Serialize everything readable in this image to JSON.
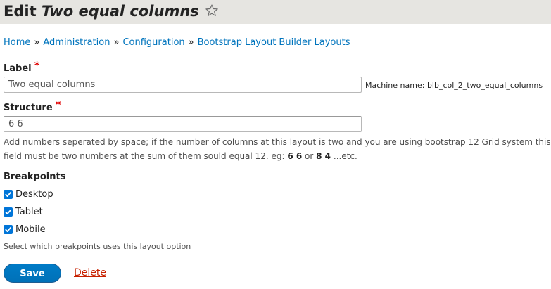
{
  "header": {
    "title_prefix": "Edit",
    "title_entity": "Two equal columns",
    "star_icon": "star-outline-icon"
  },
  "breadcrumb": {
    "items": [
      "Home",
      "Administration",
      "Configuration",
      "Bootstrap Layout Builder Layouts"
    ],
    "separator": "»"
  },
  "form": {
    "label": {
      "title": "Label",
      "required_mark": "*",
      "value": "Two equal columns",
      "machine_name": "Machine name: blb_col_2_two_equal_columns"
    },
    "structure": {
      "title": "Structure",
      "required_mark": "*",
      "value": "6 6",
      "description_part1": "Add numbers seperated by space; if the number of columns at this layout is two and you are using bootstrap 12 Grid system this field must be two numbers at the sum of them sould equal 12. eg:",
      "example_1": "6 6",
      "or_word": "or",
      "example_2": "8 4",
      "description_end": "...etc."
    },
    "breakpoints": {
      "title": "Breakpoints",
      "options": [
        {
          "label": "Desktop",
          "checked": true
        },
        {
          "label": "Tablet",
          "checked": true
        },
        {
          "label": "Mobile",
          "checked": true
        }
      ],
      "help": "Select which breakpoints uses this layout option"
    }
  },
  "actions": {
    "save_label": "Save",
    "delete_label": "Delete"
  },
  "colors": {
    "link": "#0074bd",
    "primary_button": "#0071b8",
    "delete": "#c72100",
    "required": "#e00000",
    "checkbox": "#0075d8",
    "header_bg": "#e6e5e1"
  }
}
